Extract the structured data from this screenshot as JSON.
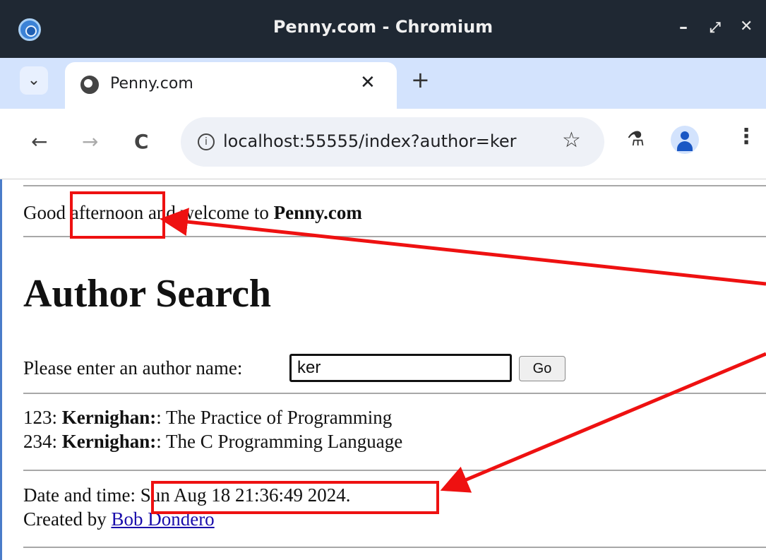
{
  "window": {
    "title": "Penny.com - Chromium",
    "controls": {
      "minimize": "–",
      "maximize": "⤢",
      "close": "✕"
    }
  },
  "tabs": [
    {
      "title": "Penny.com",
      "close": "✕",
      "icon": "globe-icon"
    }
  ],
  "tabstrip": {
    "list_icon": "⌄",
    "new_tab": "+"
  },
  "toolbar": {
    "back": "←",
    "forward": "→",
    "reload": "C",
    "info": "i",
    "url": "localhost:55555/index?author=ker",
    "star": "☆",
    "flask": "⚗",
    "menu": "⋮"
  },
  "page": {
    "greeting_prefix": "Good ",
    "greeting_time": "afternoon",
    "greeting_middle": " and welcome to ",
    "greeting_site": "Penny.com",
    "heading": "Author Search",
    "prompt": "Please enter an author name:",
    "input_value": "ker",
    "go_label": "Go",
    "results": [
      {
        "id": "123:",
        "author": "Kernighan:",
        "title": ": The Practice of Programming"
      },
      {
        "id": "234:",
        "author": "Kernighan:",
        "title": ": The C Programming Language"
      }
    ],
    "date_label": "Date and time:",
    "datetime": "Sun Aug 18 21:36:49 2024.",
    "created_by": "Created by ",
    "author_link": "Bob Dondero"
  },
  "annotation_color": "#ee1111"
}
